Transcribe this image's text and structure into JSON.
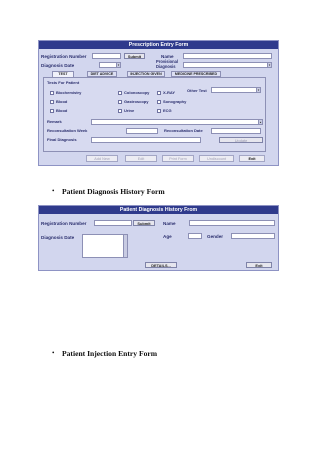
{
  "form1": {
    "title": "Prescription Entry Form",
    "registration_label": "Registration Number",
    "submit_label": "Submit",
    "name_label": "Name",
    "diagnosis_date_label": "Diagnosis Date",
    "provisional_label": "Provisional Diagnosis",
    "tabs": [
      "TEST",
      "DIET ADVICE",
      "INJECTION GIVEN",
      "MEDICINE PRESCRIBED"
    ],
    "tests_for_patient": "Tests For Patient",
    "tests": [
      "Biochemistry",
      "Colonoscopy",
      "X-RAY",
      "Blood",
      "Gastroscopy",
      "Sonography",
      "Blood",
      "Urine",
      "ECG"
    ],
    "other_test_label": "Other Test",
    "remark_label": "Remark",
    "reconsultation_week_label": "Reconsultation Week",
    "reconsultation_date_label": "Reconsultation Date",
    "final_diagnosis_label": "Final Diagnosis",
    "update_label": "Update",
    "bottom_buttons": [
      "Add New",
      "Edit",
      "Print Form",
      "Undiscount",
      "Exit"
    ]
  },
  "bullet1": "Patient Diagnosis History Form",
  "form2": {
    "title": "Patient Diagnosis History From",
    "registration_label": "Registration Number",
    "submit_label": "Submit",
    "name_label": "Name",
    "diagnosis_date_label": "Diagnosis Date",
    "age_label": "Age",
    "gender_label": "Gender",
    "details_label": "DETAILS...",
    "exit_label": "Exit"
  },
  "bullet2": "Patient Injection Entry Form"
}
